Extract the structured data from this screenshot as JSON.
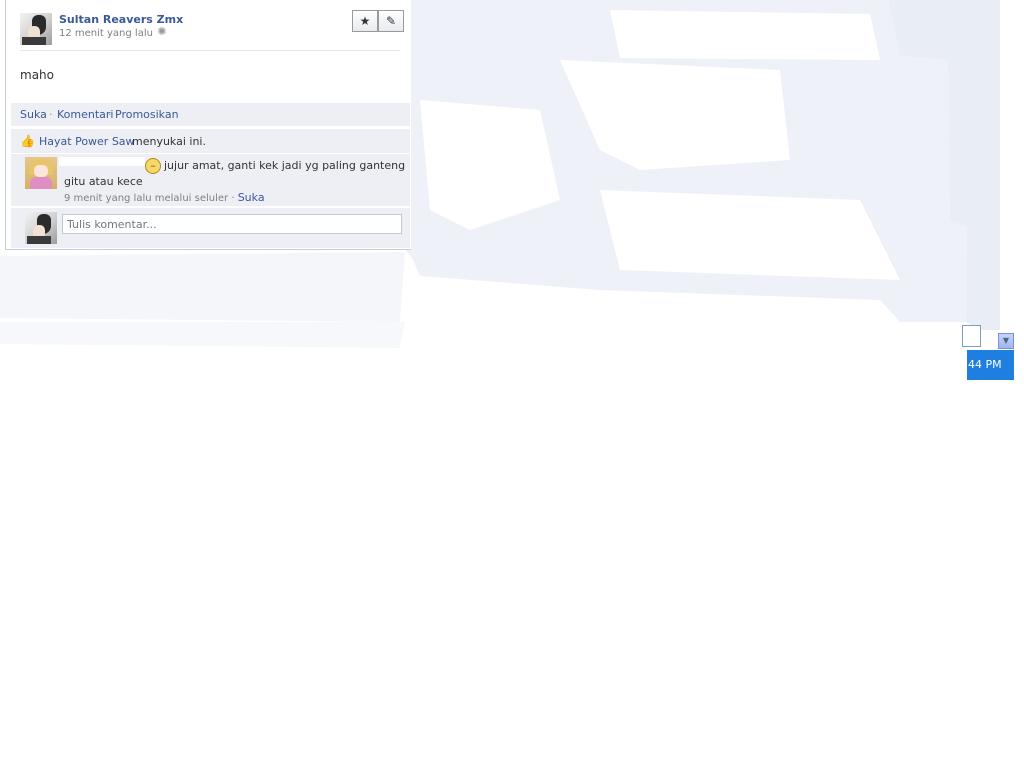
{
  "post": {
    "author": "Sultan Reavers Zmx",
    "time": "12 menit yang lalu",
    "status": "maho",
    "gear_icon": "gear-icon",
    "star_icon": "star-icon",
    "edit_icon": "pencil-icon",
    "star_glyph": "★",
    "edit_glyph": "✎",
    "gear_glyph": "✺"
  },
  "actions": {
    "like": "Suka",
    "comment": "Komentari",
    "promote": "Promosikan",
    "separator": "·"
  },
  "likes": {
    "liker": "Hayat Power Saw",
    "text": "menyukai ini.",
    "icon": "thumbs-up-icon",
    "glyph": "👍"
  },
  "comment": {
    "text_line1": "jujur amat, ganti kek jadi yg paling ganteng",
    "text_line2": "gitu atau kece",
    "meta": "9 menit yang lalu melalui seluler ·",
    "like": "Suka",
    "emoji_icon": "unamused-face-icon",
    "emoji_glyph": "–"
  },
  "write": {
    "placeholder": "Tulis komentar..."
  },
  "taskbar": {
    "clock": "44 PM",
    "scroll_glyph": "▼"
  },
  "colors": {
    "link": "#3b5998",
    "panel": "#edeff4",
    "border": "#c4cde0",
    "taskbar": "#1f7fe0",
    "background_tint": "#eff1f7"
  }
}
